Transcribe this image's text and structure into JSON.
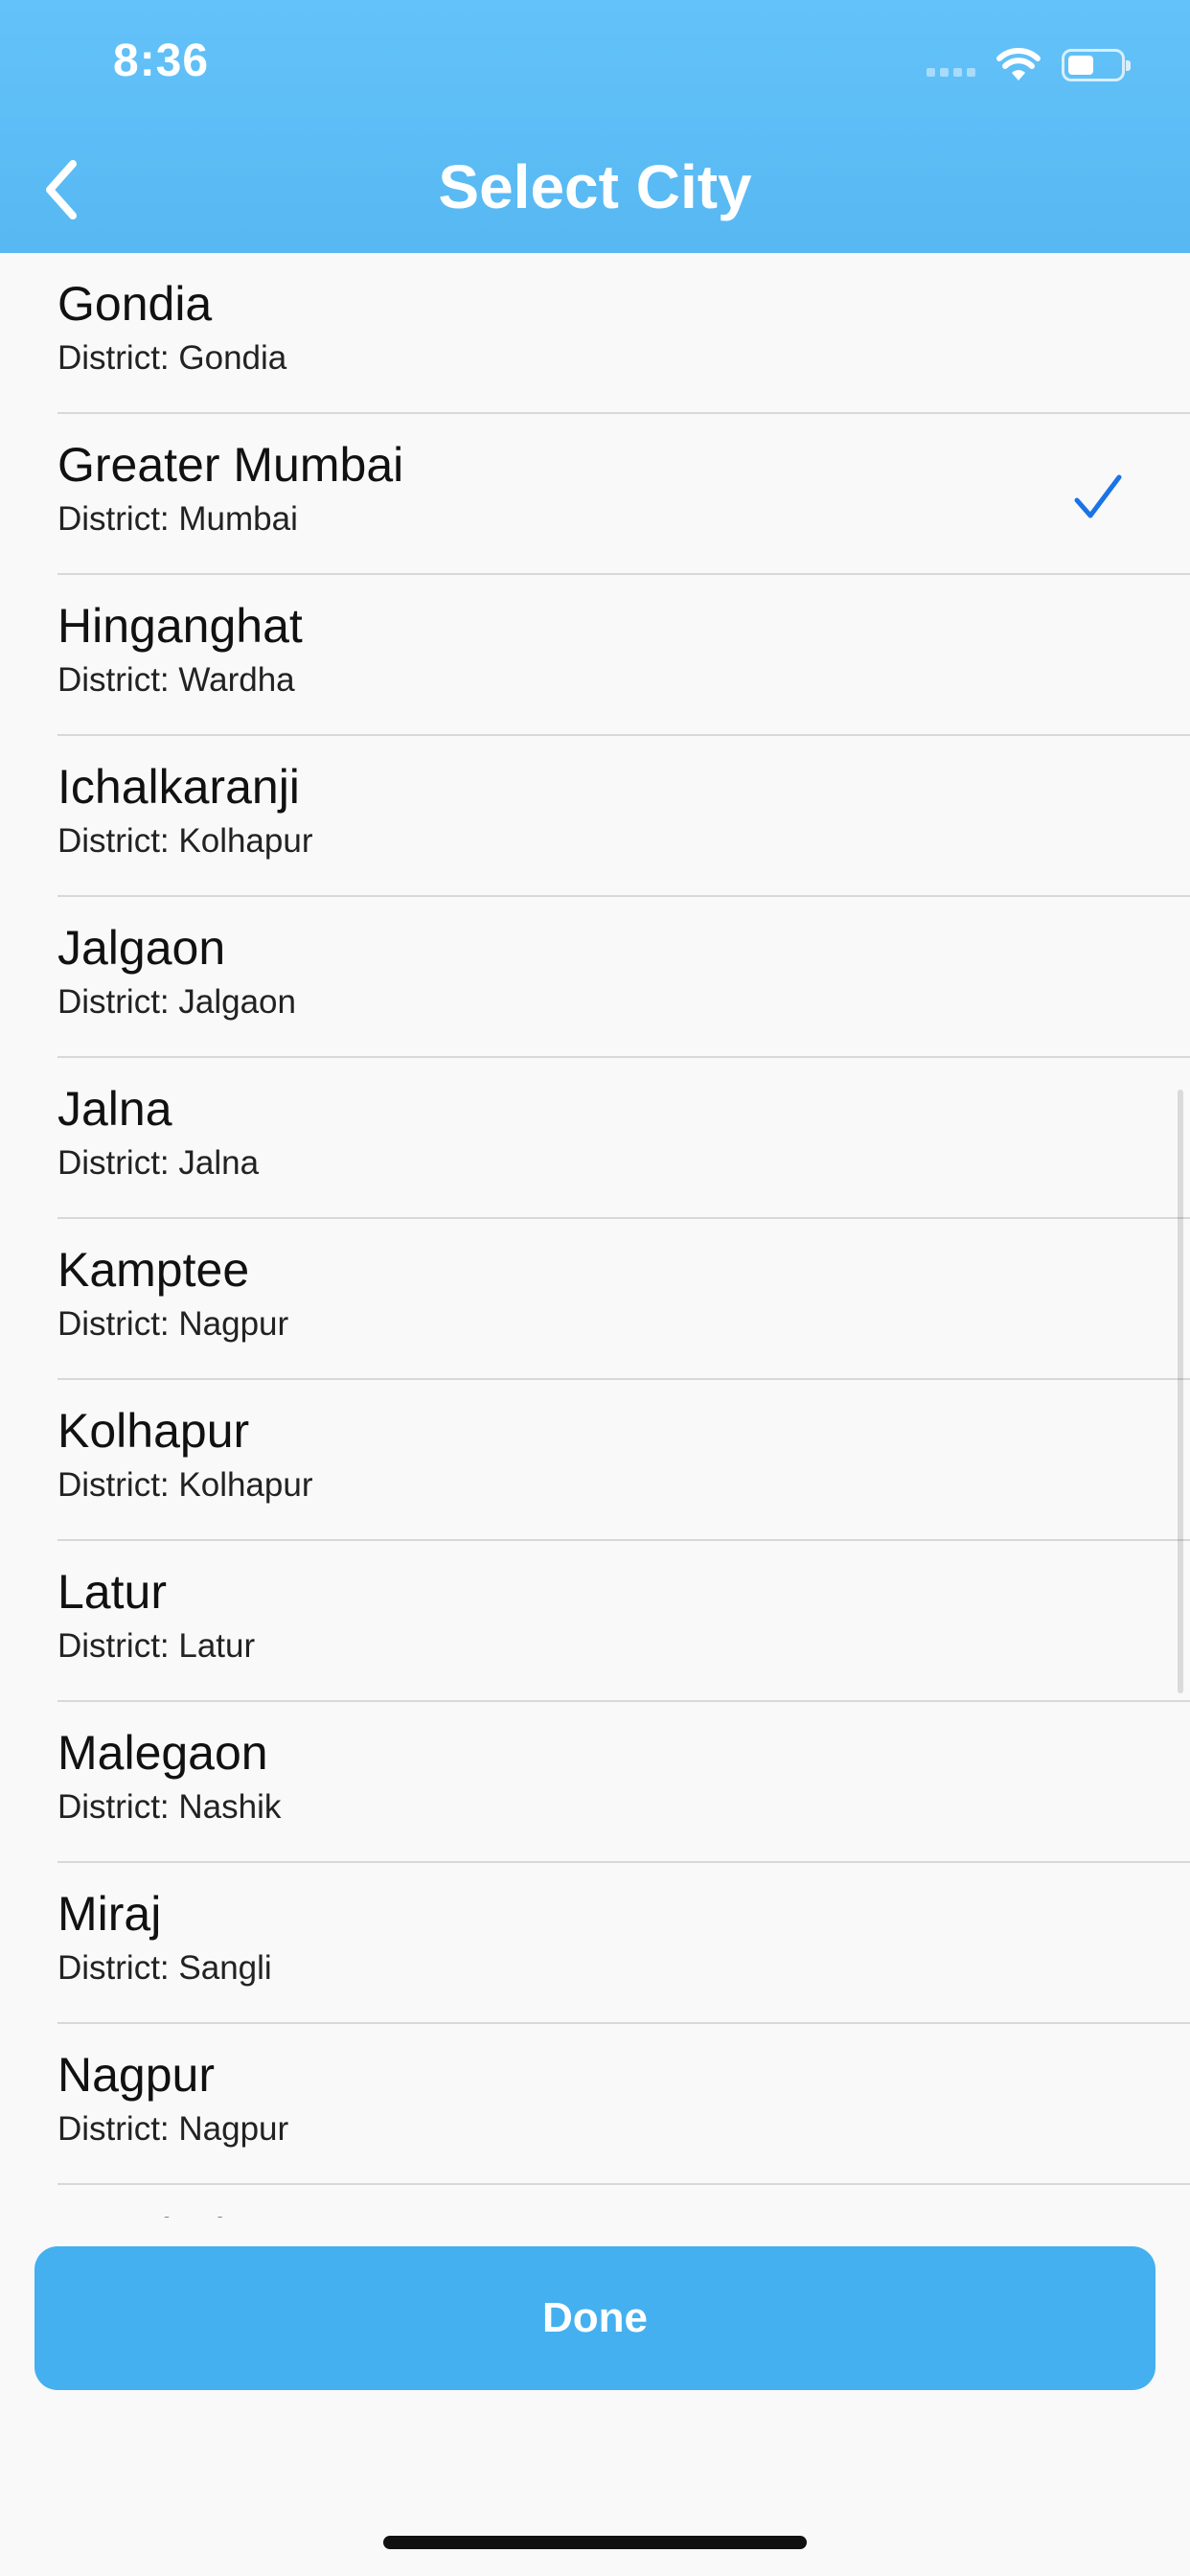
{
  "status_bar": {
    "time": "8:36",
    "wifi_icon": "wifi-icon",
    "battery_icon": "battery-icon",
    "signal_icon": "signal-icon"
  },
  "nav": {
    "title": "Select City",
    "back_icon": "chevron-left-icon"
  },
  "list": {
    "items": [
      {
        "name": "Gondia",
        "district": "District: Gondia",
        "selected": false
      },
      {
        "name": "Greater Mumbai",
        "district": "District: Mumbai",
        "selected": true
      },
      {
        "name": "Hinganghat",
        "district": "District: Wardha",
        "selected": false
      },
      {
        "name": "Ichalkaranji",
        "district": "District: Kolhapur",
        "selected": false
      },
      {
        "name": "Jalgaon",
        "district": "District: Jalgaon",
        "selected": false
      },
      {
        "name": "Jalna",
        "district": "District: Jalna",
        "selected": false
      },
      {
        "name": "Kamptee",
        "district": "District: Nagpur",
        "selected": false
      },
      {
        "name": "Kolhapur",
        "district": "District: Kolhapur",
        "selected": false
      },
      {
        "name": "Latur",
        "district": "District: Latur",
        "selected": false
      },
      {
        "name": "Malegaon",
        "district": "District: Nashik",
        "selected": false
      },
      {
        "name": "Miraj",
        "district": "District: Sangli",
        "selected": false
      },
      {
        "name": "Nagpur",
        "district": "District: Nagpur",
        "selected": false
      },
      {
        "name": "Nanded",
        "district": "",
        "selected": false
      }
    ],
    "check_icon": "checkmark-icon",
    "check_color": "#1a73e8"
  },
  "footer": {
    "done_label": "Done",
    "button_color": "#44b0f0"
  },
  "colors": {
    "header": "#5bbcf5",
    "background": "#f9f9f9"
  }
}
